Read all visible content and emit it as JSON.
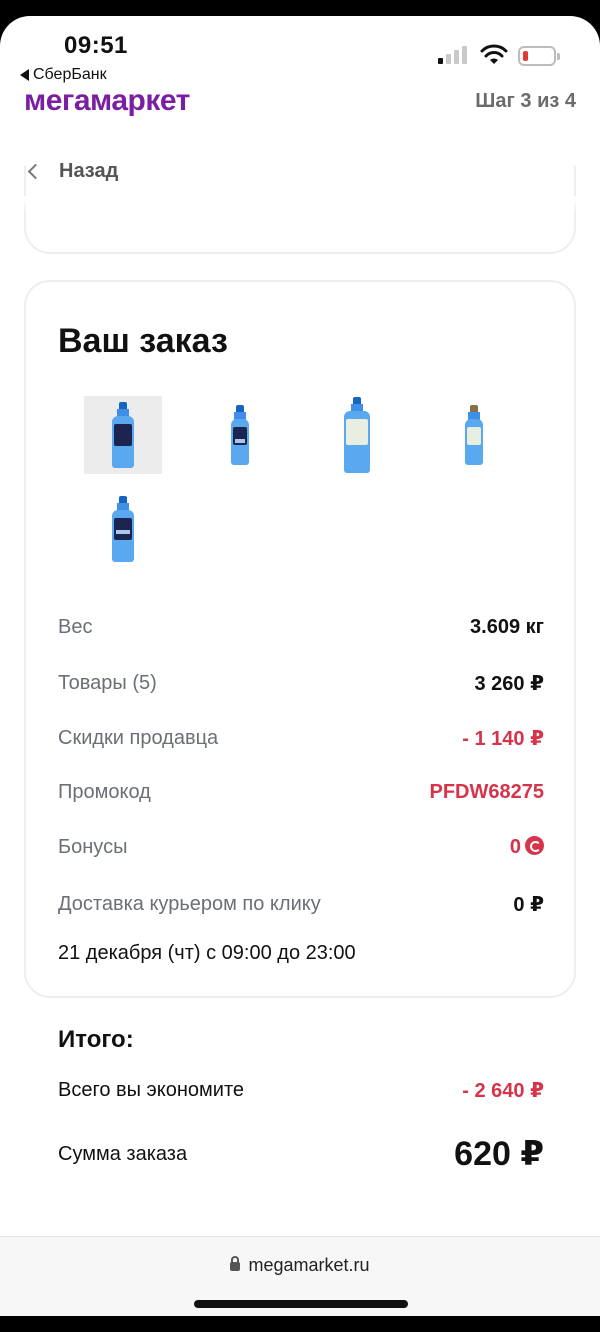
{
  "status_bar": {
    "time": "09:51",
    "back_app": "СберБанк"
  },
  "header": {
    "brand": "мегамаркет",
    "step": "Шаг 3 из 4",
    "back_label": "Назад"
  },
  "order": {
    "title": "Ваш заказ",
    "thumbnails": [
      "product-1",
      "product-2",
      "product-3",
      "product-4",
      "product-5"
    ],
    "rows": [
      {
        "label": "Вес",
        "value": "3.609 кг"
      },
      {
        "label": "Товары (5)",
        "value": "3 260 ₽"
      },
      {
        "label": "Скидки продавца",
        "value": "- 1 140 ₽"
      },
      {
        "label": "Промокод",
        "value": "PFDW68275"
      },
      {
        "label": "Бонусы",
        "value": "0"
      },
      {
        "label": "Доставка курьером по клику",
        "value": "0 ₽"
      }
    ],
    "delivery_date": "21 декабря (чт) с 09:00 до 23:00",
    "total_title": "Итого:",
    "savings_label": "Всего вы экономите",
    "savings_value": "- 2 640 ₽",
    "sum_label": "Сумма заказа",
    "sum_value": "620 ₽"
  },
  "browser": {
    "url": "megamarket.ru"
  },
  "colors": {
    "brand": "#7b1fa2",
    "discount_red": "#d5344a"
  }
}
